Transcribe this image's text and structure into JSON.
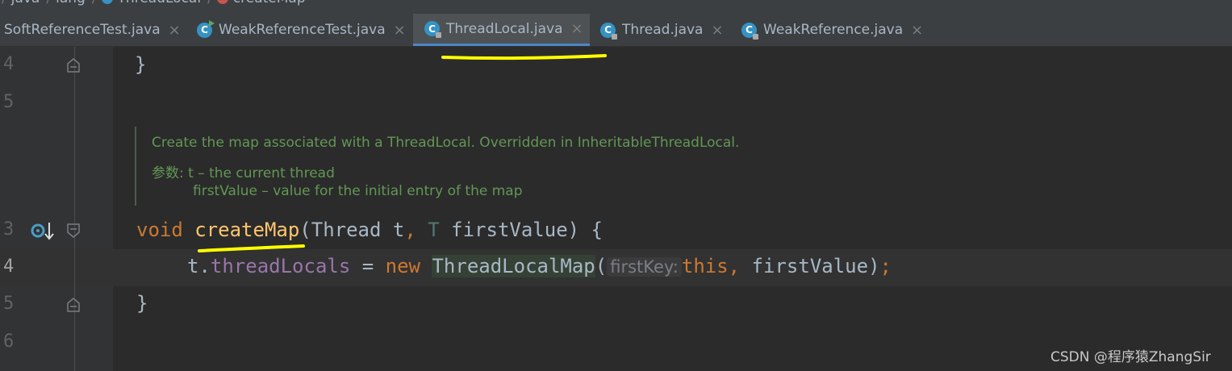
{
  "breadcrumb": {
    "items": [
      "java",
      "lang",
      "ThreadLocal",
      "createMap"
    ]
  },
  "tabs": [
    {
      "label": "SoftReferenceTest.java",
      "active": false,
      "close": "×"
    },
    {
      "label": "WeakReferenceTest.java",
      "active": false,
      "close": "×"
    },
    {
      "label": "ThreadLocal.java",
      "active": true,
      "close": "×"
    },
    {
      "label": "Thread.java",
      "active": false,
      "close": "×"
    },
    {
      "label": "WeakReference.java",
      "active": false,
      "close": "×"
    }
  ],
  "file_icon_letter": "C",
  "line_numbers": [
    "4",
    "5",
    "3",
    "4",
    "5",
    "6"
  ],
  "code": {
    "brace_close_1": "}",
    "sig_void": "void",
    "sig_name": "createMap",
    "sig_open": "(Thread t",
    "sig_comma": ",",
    "sig_T": "T",
    "sig_rest": " firstValue) {",
    "body_t": "t.",
    "body_field": "threadLocals",
    "body_eq": " = ",
    "body_new": "new",
    "body_type": "ThreadLocalMap",
    "body_paren": "(",
    "body_hint": "firstKey:",
    "body_this": "this,",
    "body_rest": " firstValue)",
    "body_semi": ";",
    "brace_close_2": "}"
  },
  "doc": {
    "line1": "Create the map associated with a ThreadLocal. Overridden in InheritableThreadLocal.",
    "line2": "参数: t – the current thread",
    "line3": "firstValue – value for the initial entry of the map"
  },
  "watermark": "CSDN @程序猿ZhangSir",
  "colors": {
    "background": "#2b2b2b",
    "keyword": "#cc7832",
    "method": "#ffc66d",
    "field": "#9876aa",
    "doc": "#629755",
    "annotation_marker": "#ffff00"
  }
}
